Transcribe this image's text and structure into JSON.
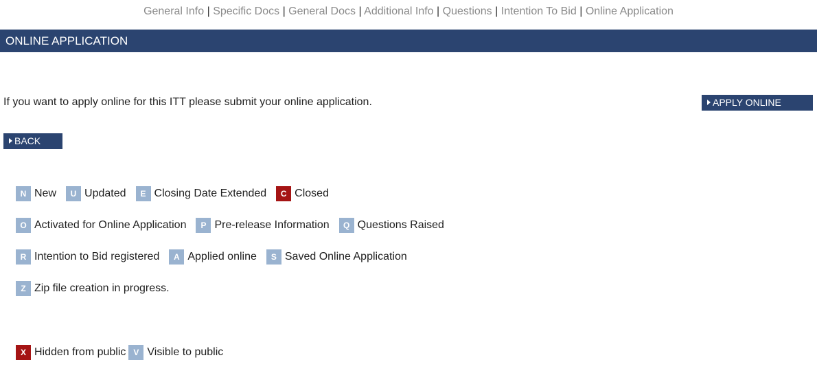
{
  "nav": {
    "items": [
      "General Info",
      "Specific Docs",
      "General Docs",
      "Additional Info",
      "Questions",
      "Intention To Bid",
      "Online Application"
    ],
    "separator": "|"
  },
  "header": {
    "title": "ONLINE APPLICATION"
  },
  "main": {
    "intro_text": "If you want to apply online for this ITT please submit your online application.",
    "apply_button": "APPLY ONLINE",
    "back_button": "BACK"
  },
  "legend": {
    "rows": [
      [
        {
          "badge": "N",
          "label": "New",
          "color": "#9ab3d0"
        },
        {
          "badge": "U",
          "label": "Updated",
          "color": "#9ab3d0"
        },
        {
          "badge": "E",
          "label": "Closing Date Extended",
          "color": "#9ab3d0"
        },
        {
          "badge": "C",
          "label": "Closed",
          "color": "#a51414"
        }
      ],
      [
        {
          "badge": "O",
          "label": "Activated for Online Application",
          "color": "#9ab3d0"
        },
        {
          "badge": "P",
          "label": "Pre-release Information",
          "color": "#9ab3d0"
        },
        {
          "badge": "Q",
          "label": "Questions Raised",
          "color": "#9ab3d0"
        }
      ],
      [
        {
          "badge": "R",
          "label": "Intention to Bid registered",
          "color": "#9ab3d0"
        },
        {
          "badge": "A",
          "label": "Applied online",
          "color": "#9ab3d0"
        },
        {
          "badge": "S",
          "label": "Saved Online Application",
          "color": "#9ab3d0"
        }
      ],
      [
        {
          "badge": "Z",
          "label": "Zip file creation in progress.",
          "color": "#9ab3d0"
        }
      ]
    ],
    "visibility_row": [
      {
        "badge": "X",
        "label": "Hidden from public",
        "color": "#a51414"
      },
      {
        "badge": "V",
        "label": "Visible to public",
        "color": "#9ab3d0"
      }
    ]
  },
  "colors": {
    "header_bg": "#2b4470",
    "badge_blue": "#9ab3d0",
    "badge_red": "#a51414"
  }
}
